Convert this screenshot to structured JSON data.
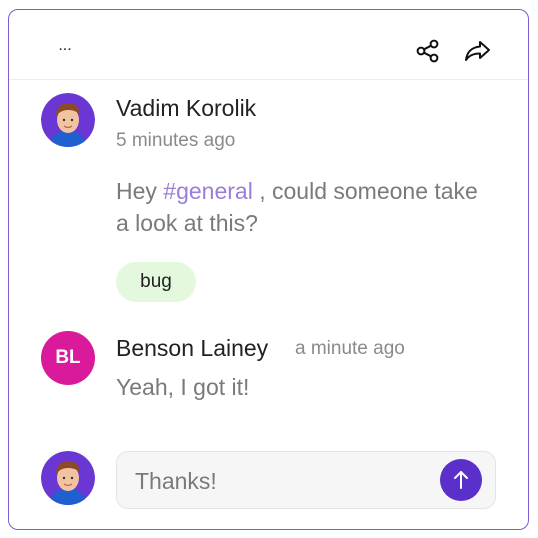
{
  "toolbar": {
    "more_label": "...",
    "share_icon": "share-icon",
    "forward_icon": "forward-arrow-icon"
  },
  "messages": [
    {
      "author": "Vadim Korolik",
      "timestamp": "5 minutes ago",
      "text_before": "Hey ",
      "mention": "#general",
      "text_after": " , could someone take a look at this?",
      "tag": "bug",
      "avatar": "user-photo"
    },
    {
      "author": "Benson Lainey",
      "timestamp": "a minute ago",
      "text": "Yeah, I got it!",
      "avatar_initials": "BL",
      "avatar_color": "#d91b9b"
    }
  ],
  "reply": {
    "value": "Thanks!",
    "send_icon": "arrow-up-icon"
  },
  "colors": {
    "accent": "#5b2fc9",
    "border": "#7c5cd6",
    "mention": "#9a7fd9",
    "tag_bg": "#e3f8dc"
  }
}
